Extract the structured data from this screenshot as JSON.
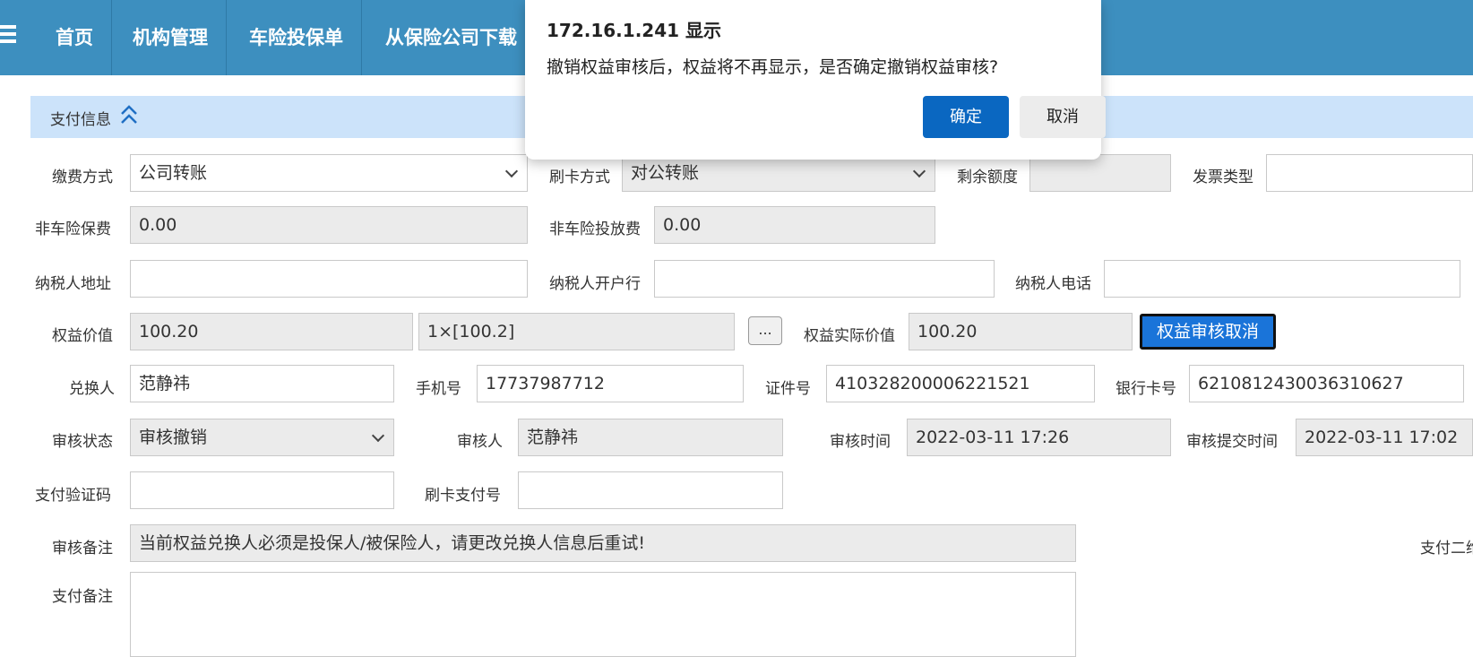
{
  "nav": {
    "items": [
      "首页",
      "机构管理",
      "车险投保单",
      "从保险公司下载"
    ]
  },
  "section": {
    "title": "支付信息"
  },
  "form": {
    "payment_method": {
      "label": "缴费方式",
      "value": "公司转账"
    },
    "card_method": {
      "label": "刷卡方式",
      "value": "对公转账"
    },
    "remaining_quota": {
      "label": "剩余额度",
      "value": ""
    },
    "invoice_type": {
      "label": "发票类型",
      "value": ""
    },
    "non_auto_premium": {
      "label": "非车险保费",
      "value": "0.00"
    },
    "non_auto_fee": {
      "label": "非车险投放费",
      "value": "0.00"
    },
    "taxpayer_address": {
      "label": "纳税人地址",
      "value": ""
    },
    "taxpayer_bank": {
      "label": "纳税人开户行",
      "value": ""
    },
    "taxpayer_phone": {
      "label": "纳税人电话",
      "value": ""
    },
    "benefit_value": {
      "label": "权益价值",
      "value": "100.20",
      "detail": "1×[100.2]"
    },
    "dots_label": "...",
    "benefit_actual_value": {
      "label": "权益实际价值",
      "value": "100.20"
    },
    "cancel_review_button": "权益审核取消",
    "redeemer": {
      "label": "兑换人",
      "value": "范静祎"
    },
    "phone": {
      "label": "手机号",
      "value": "17737987712"
    },
    "id_number": {
      "label": "证件号",
      "value": "410328200006221521"
    },
    "bank_card": {
      "label": "银行卡号",
      "value": "6210812430036310627"
    },
    "review_status": {
      "label": "审核状态",
      "value": "审核撤销"
    },
    "reviewer": {
      "label": "审核人",
      "value": "范静祎"
    },
    "review_time": {
      "label": "审核时间",
      "value": "2022-03-11 17:26"
    },
    "review_submit_time": {
      "label": "审核提交时间",
      "value": "2022-03-11 17:02"
    },
    "payment_code": {
      "label": "支付验证码",
      "value": ""
    },
    "card_payment_no": {
      "label": "刷卡支付号",
      "value": ""
    },
    "review_note": {
      "label": "审核备注",
      "value": "当前权益兑换人必须是投保人/被保险人，请更改兑换人信息后重试!"
    },
    "payment_qr_label": "支付二维",
    "payment_note": {
      "label": "支付备注",
      "value": ""
    }
  },
  "dialog": {
    "title": "172.16.1.241 显示",
    "message": "撤销权益审核后，权益将不再显示，是否确定撤销权益审核?",
    "ok_label": "确定",
    "cancel_label": "取消"
  },
  "colors": {
    "topbar": "#3d8fbf",
    "section_bar": "#cce3fa",
    "primary_button": "#1a74d9",
    "dialog_ok": "#0a67c1"
  }
}
